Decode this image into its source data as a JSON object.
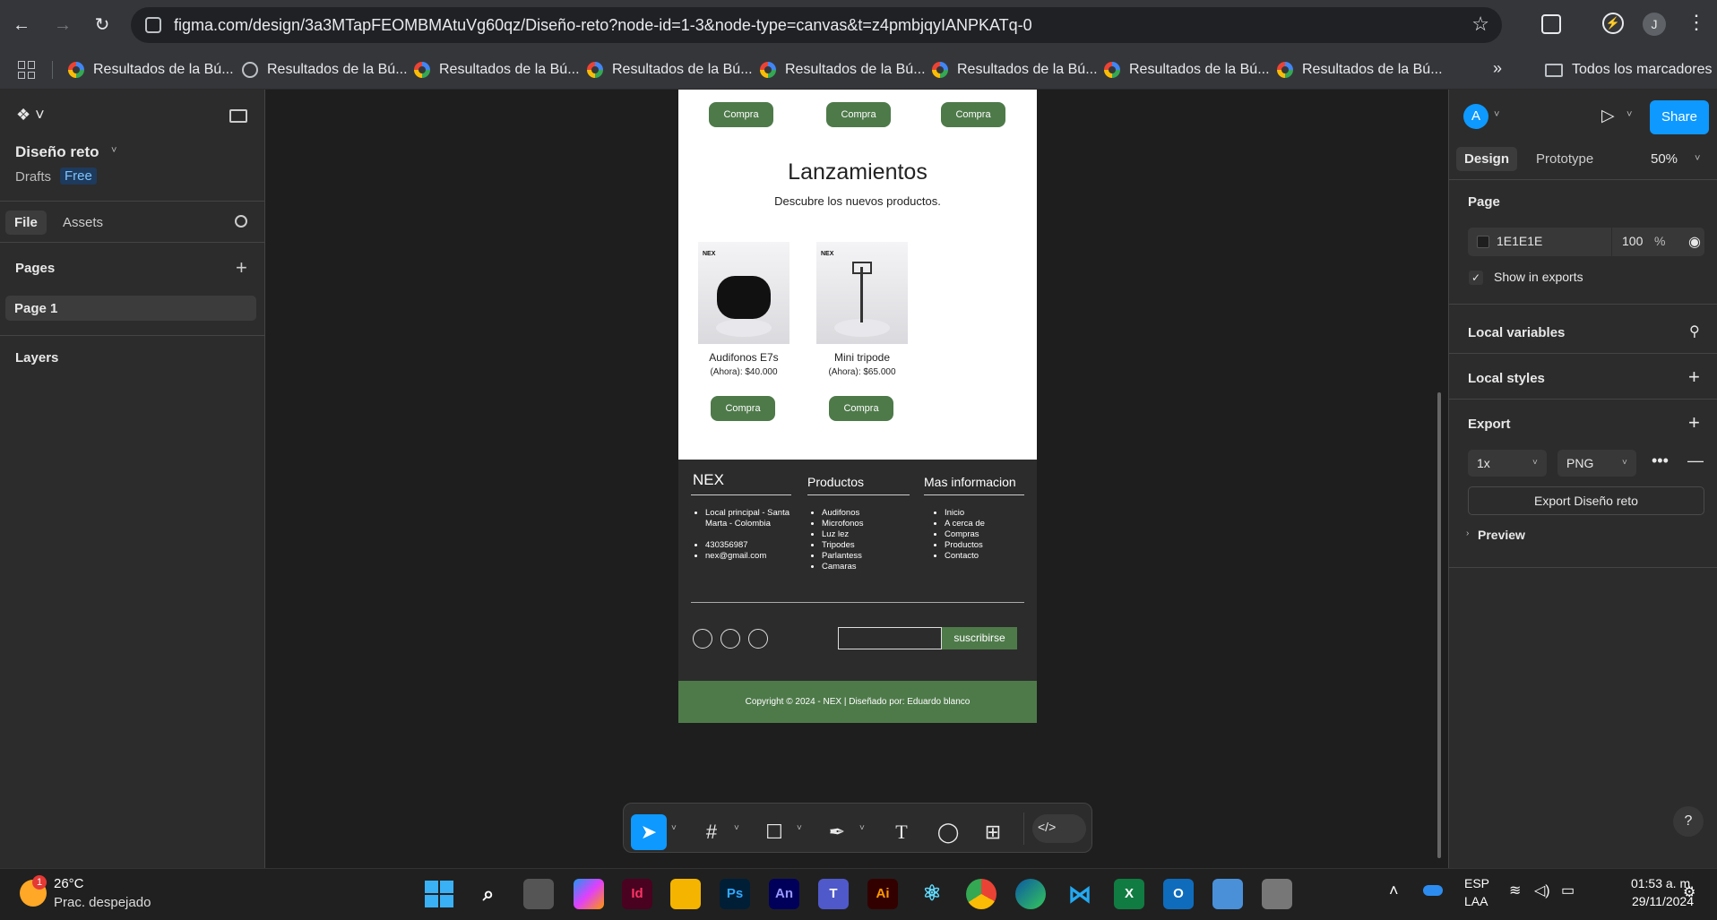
{
  "browser": {
    "url": "figma.com/design/3a3MTapFEOMBMAtuVg60qz/Diseño-reto?node-id=1-3&node-type=canvas&t=z4pmbjqyIANPKATq-0",
    "bookmarks": [
      "Resultados de la Bú...",
      "Resultados de la Bú...",
      "Resultados de la Bú...",
      "Resultados de la Bú...",
      "Resultados de la Bú...",
      "Resultados de la Bú...",
      "Resultados de la Bú...",
      "Resultados de la Bú..."
    ],
    "all_bookmarks": "Todos los marcadores",
    "profile_initial": "J"
  },
  "left_panel": {
    "file_name": "Diseño reto",
    "drafts": "Drafts",
    "plan_badge": "Free",
    "tab_file": "File",
    "tab_assets": "Assets",
    "pages_label": "Pages",
    "page_1": "Page 1",
    "layers_label": "Layers"
  },
  "frame": {
    "buy_label": "Compra",
    "section_title": "Lanzamientos",
    "section_subtitle": "Descubre los nuevos productos.",
    "products": [
      {
        "badge": "NEX",
        "name": "Audifonos E7s",
        "price": "(Ahora): $40.000"
      },
      {
        "badge": "NEX",
        "name": "Mini tripode",
        "price": "(Ahora): $65.000"
      }
    ],
    "footer": {
      "brand": "NEX",
      "products_title": "Productos",
      "more_title": "Mas informacion",
      "address": "Local principal - Santa Marta - Colombia",
      "phone": "430356987",
      "email": "nex@gmail.com",
      "product_links": [
        "Audifonos",
        "Microfonos",
        "Luz lez",
        "Tripodes",
        "Parlantess",
        "Camaras"
      ],
      "info_links": [
        "Inicio",
        "A cerca de",
        "Compras",
        "Productos",
        "Contacto"
      ],
      "subscribe": "suscribirse",
      "copyright": "Copyright © 2024 - NEX | Diseñado por: Eduardo blanco"
    }
  },
  "right_panel": {
    "avatar": "A",
    "share": "Share",
    "tab_design": "Design",
    "tab_prototype": "Prototype",
    "zoom": "50%",
    "page_label": "Page",
    "page_color": "1E1E1E",
    "page_opacity": "100",
    "percent": "%",
    "show_in_exports": "Show in exports",
    "local_variables": "Local variables",
    "local_styles": "Local styles",
    "export_label": "Export",
    "export_scale": "1x",
    "export_format": "PNG",
    "export_button": "Export Diseño reto",
    "preview": "Preview",
    "help": "?"
  },
  "taskbar": {
    "weather_temp": "26°C",
    "weather_desc": "Prac. despejado",
    "weather_badge": "1",
    "lang_1": "ESP",
    "lang_2": "LAA",
    "time": "01:53 a. m.",
    "date": "29/11/2024"
  },
  "colors": {
    "accent_blue": "#0d99ff",
    "green": "#4e7a4a",
    "footer_dark": "#2c2c2c",
    "canvas_bg": "#1e1e1e"
  }
}
